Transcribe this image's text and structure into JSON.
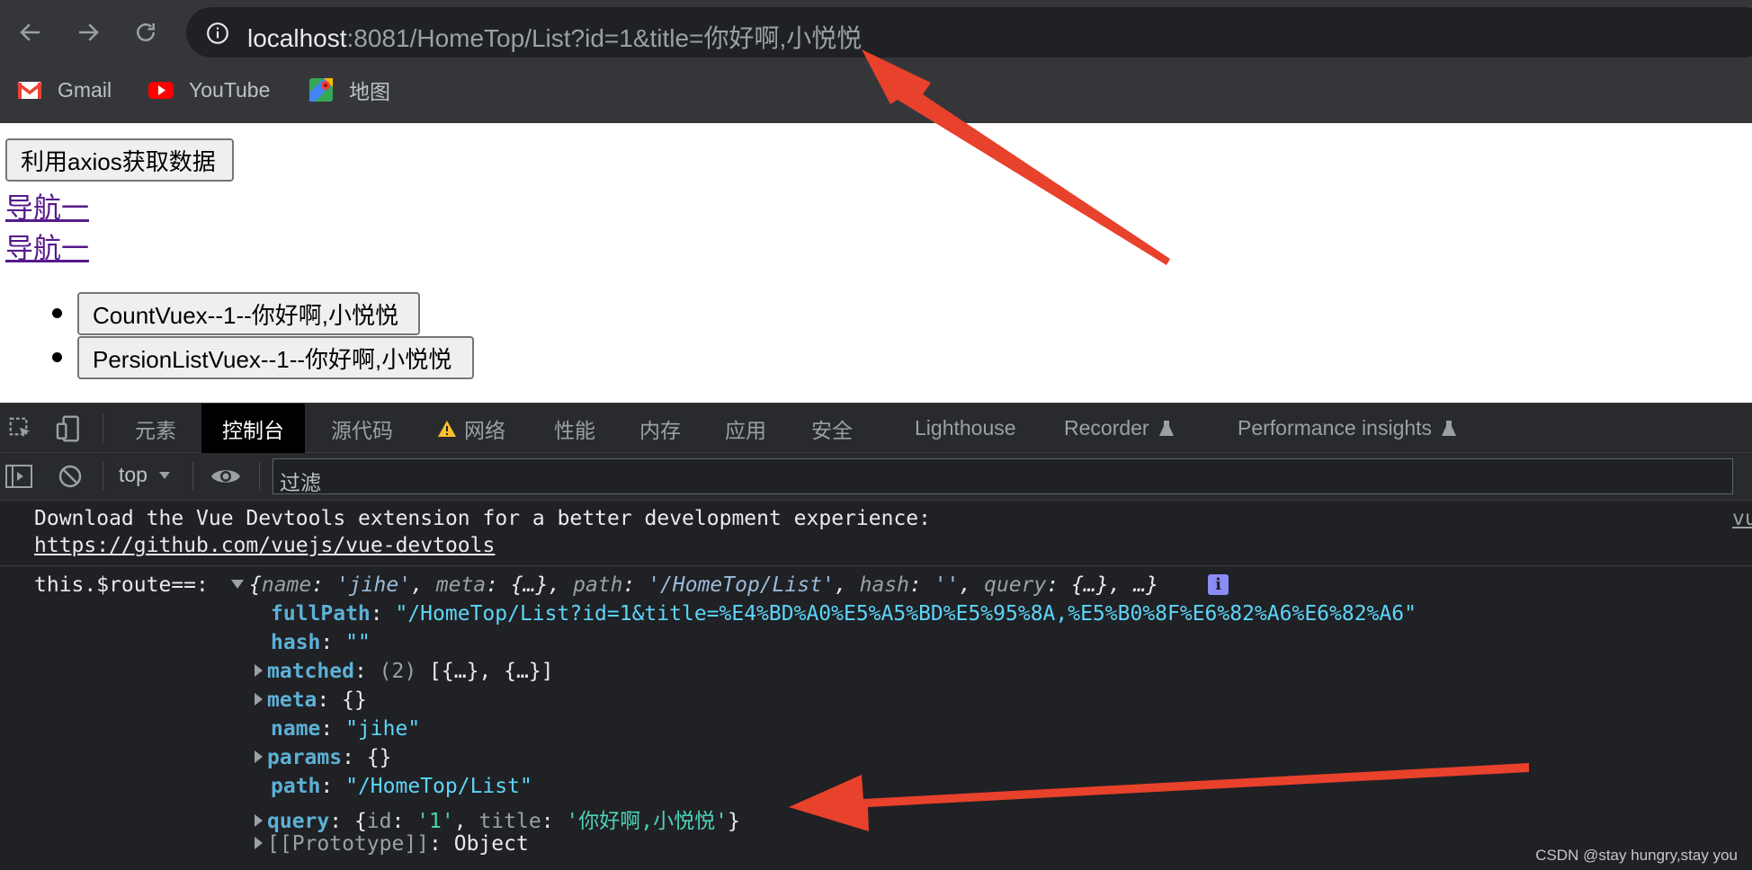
{
  "browser": {
    "url_host": "localhost",
    "url_rest": ":8081/HomeTop/List?id=1&title=你好啊,小悦悦",
    "bookmarks": [
      {
        "label": "Gmail",
        "icon": "gmail-icon"
      },
      {
        "label": "YouTube",
        "icon": "youtube-icon"
      },
      {
        "label": "地图",
        "icon": "maps-icon"
      }
    ]
  },
  "page": {
    "fetch_button": "利用axios获取数据",
    "links": [
      "导航一",
      "导航一"
    ],
    "list_buttons": [
      "CountVuex--1--你好啊,小悦悦",
      "PersionListVuex--1--你好啊,小悦悦"
    ]
  },
  "devtools": {
    "tabs": [
      "元素",
      "控制台",
      "源代码",
      "网络",
      "性能",
      "内存",
      "应用",
      "安全",
      "Lighthouse",
      "Recorder",
      "Performance insights"
    ],
    "active_tab": "控制台",
    "context": "top",
    "filter_placeholder": "过滤",
    "console": {
      "devtools_message": "Download the Vue Devtools extension for a better development experience:",
      "devtools_link": "https://github.com/vuejs/vue-devtools",
      "source_link": "vu",
      "log_label": "this.$route==:",
      "summary": {
        "name_key": "name",
        "name_val": "'jihe'",
        "meta_key": "meta",
        "meta_val": "{…}",
        "path_key": "path",
        "path_val": "'/HomeTop/List'",
        "hash_key": "hash",
        "hash_val": "''",
        "query_key": "query",
        "query_val": "{…}",
        "more": "…}"
      },
      "props": {
        "fullPath_key": "fullPath",
        "fullPath_val": "\"/HomeTop/List?id=1&title=%E4%BD%A0%E5%A5%BD%E5%95%8A,%E5%B0%8F%E6%82%A6%E6%82%A6\"",
        "hash_key": "hash",
        "hash_val": "\"\"",
        "matched_key": "matched",
        "matched_count": "(2)",
        "matched_val": "[{…}, {…}]",
        "meta_key": "meta",
        "meta_val": "{}",
        "name_key": "name",
        "name_val": "\"jihe\"",
        "params_key": "params",
        "params_val": "{}",
        "path_key": "path",
        "path_val": "\"/HomeTop/List\"",
        "query_key": "query",
        "query_id_key": "id",
        "query_id_val": "'1'",
        "query_title_key": "title",
        "query_title_val": "'你好啊,小悦悦'",
        "proto_key": "[[Prototype]]",
        "proto_val": "Object"
      }
    }
  },
  "watermark": "CSDN @stay hungry,stay you",
  "colors": {
    "annotation_arrow": "#e8412c",
    "link_visited": "#551a8b",
    "console_key": "#5db0d7",
    "console_string": "#5cd5fb"
  }
}
